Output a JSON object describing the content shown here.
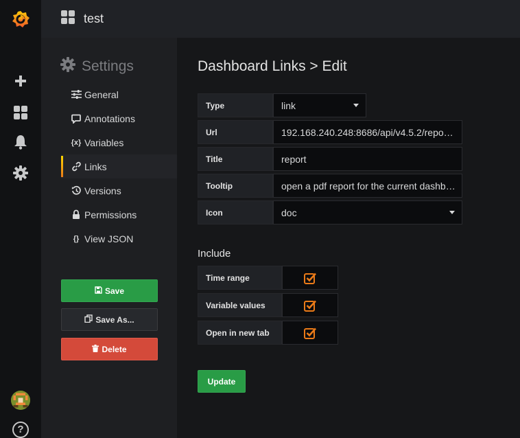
{
  "topbar": {
    "title": "test"
  },
  "rail": {
    "icons": [
      "grafana-logo-icon",
      "plus-icon",
      "dashboards-icon",
      "alert-bell-icon",
      "gear-icon"
    ],
    "help_label": "?"
  },
  "sidebar": {
    "title": "Settings",
    "items": [
      {
        "label": "General",
        "icon": "sliders-icon"
      },
      {
        "label": "Annotations",
        "icon": "comment-icon"
      },
      {
        "label": "Variables",
        "icon": "variables-icon",
        "glyph": "{x}"
      },
      {
        "label": "Links",
        "icon": "link-icon",
        "active": true
      },
      {
        "label": "Versions",
        "icon": "history-icon"
      },
      {
        "label": "Permissions",
        "icon": "lock-icon"
      },
      {
        "label": "View JSON",
        "icon": "json-icon",
        "glyph": "{}"
      }
    ],
    "save_label": "Save",
    "save_as_label": "Save As...",
    "delete_label": "Delete"
  },
  "main": {
    "title": "Dashboard Links > Edit",
    "form": {
      "type_label": "Type",
      "type_value": "link",
      "url_label": "Url",
      "url_value": "192.168.240.248:8686/api/v4.5.2/repo…",
      "title_label": "Title",
      "title_value": "report",
      "tooltip_label": "Tooltip",
      "tooltip_value": "open a pdf report for the current dashb…",
      "icon_label": "Icon",
      "icon_value": "doc"
    },
    "include": {
      "heading": "Include",
      "options": [
        {
          "label": "Time range",
          "checked": true
        },
        {
          "label": "Variable values",
          "checked": true
        },
        {
          "label": "Open in new tab",
          "checked": true
        }
      ]
    },
    "update_label": "Update"
  },
  "colors": {
    "accent_orange": "#eb7b18",
    "green": "#299c46",
    "red": "#d44a3a"
  }
}
